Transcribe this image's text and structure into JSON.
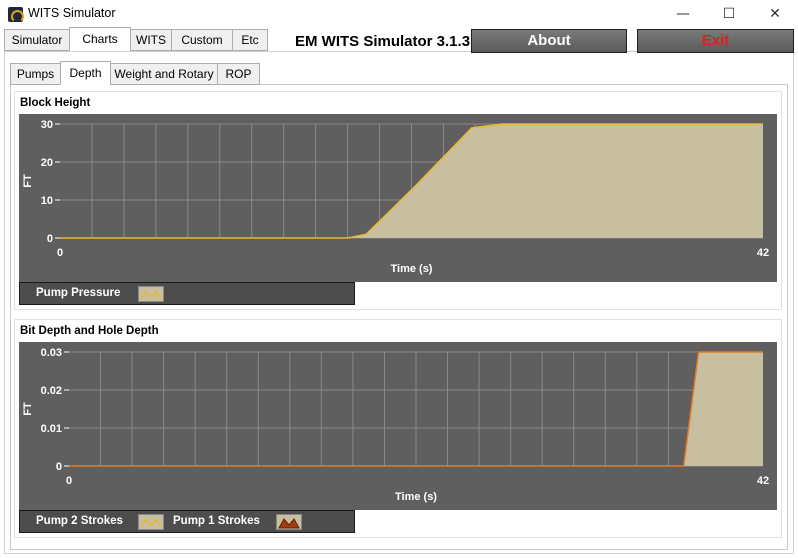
{
  "window": {
    "title": "WITS Simulator",
    "controls": {
      "minimize": "—",
      "maximize": "☐",
      "close": "✕"
    }
  },
  "main_tabs": [
    "Simulator",
    "Charts",
    "WITS",
    "Custom",
    "Etc"
  ],
  "header": {
    "title": "EM WITS Simulator 3.1.3",
    "about_label": "About",
    "exit_label": "Exit"
  },
  "sub_tabs": [
    "Pumps",
    "Depth",
    "Weight and Rotary",
    "ROP"
  ],
  "colors": {
    "plot_bg": "#5f5f5f",
    "fill": "#c8bea0",
    "line_block": "#e8b830",
    "line_depth": "#e07d20",
    "grid": "#8a8a8a",
    "exit_text": "#e02020",
    "swatch_pump_pressure": "#c8bea0",
    "swatch_pump2": "#c8bea0",
    "swatch_pump1": "#a04010"
  },
  "charts": [
    {
      "title": "Block Height",
      "legend": [
        "Pump Pressure"
      ]
    },
    {
      "title": "Bit Depth and Hole Depth",
      "legend": [
        "Pump 2 Strokes",
        "Pump 1 Strokes"
      ]
    }
  ],
  "chart_data": [
    {
      "type": "area",
      "title": "Block Height",
      "xlabel": "Time (s)",
      "ylabel": "FT",
      "xlim": [
        0,
        42
      ],
      "ylim": [
        0,
        30
      ],
      "x_ticks": [
        "0",
        "42"
      ],
      "y_ticks": [
        "0",
        "10",
        "20",
        "30"
      ],
      "y_tick_values": [
        0,
        10,
        20,
        30
      ],
      "grid": true,
      "x": [
        0,
        17.2,
        18.3,
        21.3,
        24.6,
        26.4,
        42
      ],
      "series": [
        {
          "values": [
            0,
            0,
            1,
            14,
            29,
            30,
            30
          ]
        }
      ]
    },
    {
      "type": "area",
      "title": "Bit Depth and Hole Depth",
      "xlabel": "Time (s)",
      "ylabel": "FT",
      "xlim": [
        0,
        42
      ],
      "ylim": [
        0,
        0.03
      ],
      "x_ticks": [
        "0",
        "42"
      ],
      "y_ticks": [
        "0",
        "0.01",
        "0.02",
        "0.03"
      ],
      "y_tick_values": [
        0,
        0.01,
        0.02,
        0.03
      ],
      "grid": true,
      "x": [
        0,
        37.1,
        37.2,
        38.1,
        42
      ],
      "series": [
        {
          "values": [
            0,
            0,
            0,
            0.03,
            0.03
          ]
        }
      ]
    }
  ]
}
